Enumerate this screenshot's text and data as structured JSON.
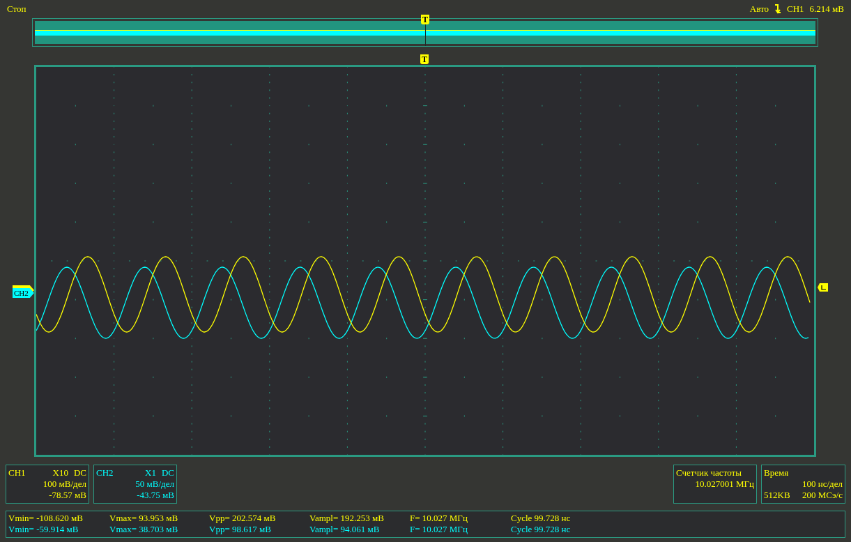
{
  "status": {
    "state": "Стоп",
    "mode": "Авто",
    "source": "CH1",
    "level": "6.214 мВ"
  },
  "memory_trigger_marker": "T",
  "screen_trigger_marker": "T",
  "channel_markers": [
    {
      "color": "#ffff00"
    },
    {
      "label": "CH2",
      "color": "#00ffff"
    }
  ],
  "channels": [
    {
      "name": "CH1",
      "probe": "X10",
      "coupling": "DC",
      "scale": "100 мВ/дел",
      "offset": "-78.57 мВ",
      "color": "#ffff00"
    },
    {
      "name": "CH2",
      "probe": "X1",
      "coupling": "DC",
      "scale": "50 мВ/дел",
      "offset": "-43.75 мВ",
      "color": "#00ffff"
    }
  ],
  "frequency_counter": {
    "title": "Счетчик частоты",
    "value": "10.027001 МГц"
  },
  "timebase": {
    "title": "Время",
    "scale": "100 нс/дел",
    "memory": "512KB",
    "sample_rate": "200 МСэ/с"
  },
  "measurements": [
    {
      "color": "#ffff00",
      "items": [
        "Vmin= -108.620 мВ",
        "Vmax= 93.953 мВ",
        "Vpp= 202.574 мВ",
        "Vampl= 192.253 мВ",
        "F= 10.027 МГц",
        "Cycle 99.728 нс"
      ]
    },
    {
      "color": "#00ffff",
      "items": [
        "Vmin= -59.914 мВ",
        "Vmax= 38.703 мВ",
        "Vpp= 98.617 мВ",
        "Vampl= 94.061 мВ",
        "F= 10.027 МГц",
        "Cycle 99.728 нс"
      ]
    }
  ]
}
